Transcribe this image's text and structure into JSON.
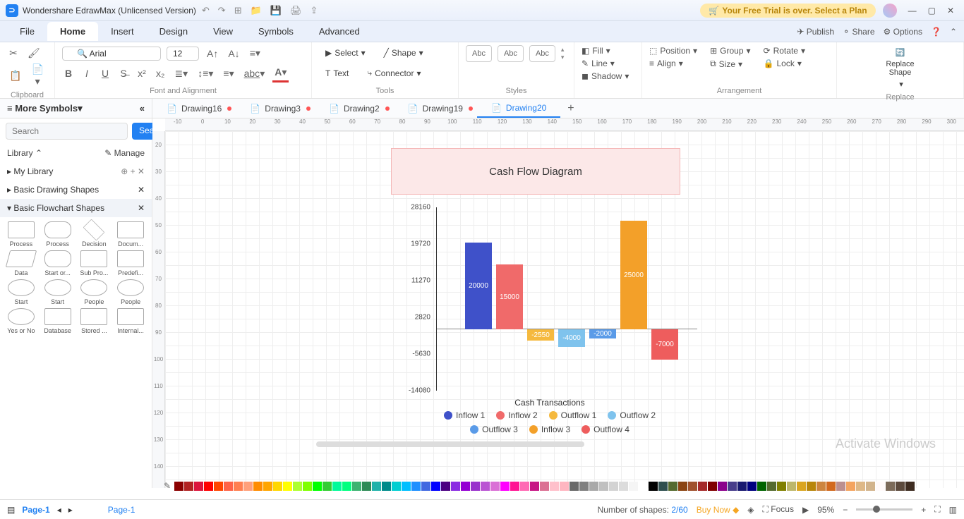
{
  "app": {
    "title": "Wondershare EdrawMax (Unlicensed Version)",
    "trial": "Your Free Trial is over. Select a Plan"
  },
  "menu": {
    "file": "File",
    "home": "Home",
    "insert": "Insert",
    "design": "Design",
    "view": "View",
    "symbols": "Symbols",
    "advanced": "Advanced",
    "publish": "Publish",
    "share": "Share",
    "options": "Options"
  },
  "ribbon": {
    "clipboard": "Clipboard",
    "font": "Arial",
    "size": "12",
    "font_align": "Font and Alignment",
    "select": "Select",
    "shape": "Shape",
    "text": "Text",
    "connector": "Connector",
    "tools": "Tools",
    "abc": "Abc",
    "styles": "Styles",
    "fill": "Fill",
    "line": "Line",
    "shadow": "Shadow",
    "position": "Position",
    "align": "Align",
    "group": "Group",
    "size_lbl": "Size",
    "rotate": "Rotate",
    "lock": "Lock",
    "arrangement": "Arrangement",
    "replace_shape": "Replace\nShape",
    "replace": "Replace"
  },
  "sidebar": {
    "more_symbols": "More Symbols",
    "search_ph": "Search",
    "search_btn": "Search",
    "library": "Library",
    "manage": "Manage",
    "my_library": "My Library",
    "basic_drawing": "Basic Drawing Shapes",
    "basic_flowchart": "Basic Flowchart Shapes",
    "shapes": [
      "Process",
      "Process",
      "Decision",
      "Docum...",
      "Data",
      "Start or...",
      "Sub Pro...",
      "Predefi...",
      "Start",
      "Start",
      "People",
      "People",
      "Yes or No",
      "Database",
      "Stored ...",
      "Internal..."
    ]
  },
  "doc_tabs": [
    "Drawing16",
    "Drawing3",
    "Drawing2",
    "Drawing19",
    "Drawing20"
  ],
  "rulers_h": [
    "-10",
    "0",
    "10",
    "20",
    "30",
    "40",
    "50",
    "60",
    "70",
    "80",
    "90",
    "100",
    "110",
    "120",
    "130",
    "140",
    "150",
    "160",
    "170",
    "180",
    "190",
    "200",
    "210",
    "220",
    "230",
    "240",
    "250",
    "260",
    "270",
    "280",
    "290",
    "300"
  ],
  "rulers_v": [
    "20",
    "30",
    "40",
    "50",
    "60",
    "70",
    "80",
    "90",
    "100",
    "110",
    "120",
    "130",
    "140"
  ],
  "chart_data": {
    "type": "bar",
    "title": "Cash Flow Diagram",
    "xlabel": "Cash Transactions",
    "ylabel": "",
    "ylim": [
      -14080,
      28160
    ],
    "y_ticks": [
      28160,
      19720,
      11270,
      2820,
      -5630,
      -14080
    ],
    "series": [
      {
        "name": "Inflow 1",
        "value": 20000,
        "color": "#3f51c9"
      },
      {
        "name": "Inflow 2",
        "value": 15000,
        "color": "#f06a6a"
      },
      {
        "name": "Outflow 1",
        "value": -2550,
        "color": "#f5b93e"
      },
      {
        "name": "Outflow 2",
        "value": -4000,
        "color": "#7fc3ed"
      },
      {
        "name": "Outflow 3",
        "value": -2000,
        "color": "#5a9be8"
      },
      {
        "name": "Inflow 3",
        "value": 25000,
        "color": "#f3a029"
      },
      {
        "name": "Outflow 4",
        "value": -7000,
        "color": "#ee5d5d"
      }
    ]
  },
  "status": {
    "page": "Page-1",
    "shapes_lbl": "Number of shapes:",
    "shapes": "2/60",
    "buy": "Buy Now",
    "focus": "Focus",
    "zoom": "95%"
  },
  "palette": [
    "#8b0000",
    "#b22222",
    "#dc143c",
    "#ff0000",
    "#ff4500",
    "#ff6347",
    "#ff7f50",
    "#ffa07a",
    "#ff8c00",
    "#ffa500",
    "#ffd700",
    "#ffff00",
    "#adff2f",
    "#7fff00",
    "#00ff00",
    "#32cd32",
    "#00fa9a",
    "#00ff7f",
    "#3cb371",
    "#2e8b57",
    "#20b2aa",
    "#008b8b",
    "#00ced1",
    "#00bfff",
    "#1e90ff",
    "#4169e1",
    "#0000ff",
    "#4b0082",
    "#8a2be2",
    "#9400d3",
    "#9932cc",
    "#ba55d3",
    "#da70d6",
    "#ff00ff",
    "#ff1493",
    "#ff69b4",
    "#c71585",
    "#db7093",
    "#ffc0cb",
    "#ffb6c1",
    "#696969",
    "#808080",
    "#a9a9a9",
    "#c0c0c0",
    "#d3d3d3",
    "#dcdcdc",
    "#f5f5f5",
    "#ffffff",
    "#000000",
    "#2f4f4f",
    "#556b2f",
    "#8b4513",
    "#a0522d",
    "#a52a2a",
    "#800000",
    "#8b008b",
    "#483d8b",
    "#191970",
    "#000080",
    "#006400",
    "#556b2f",
    "#808000",
    "#bdb76b",
    "#daa520",
    "#b8860b",
    "#cd853f",
    "#d2691e",
    "#bc8f8f",
    "#f4a460",
    "#deb887",
    "#d2b48c",
    "#fffafa",
    "#7c6b5a",
    "#5c4a3d",
    "#3e2c20"
  ],
  "watermark": "Activate Windows"
}
